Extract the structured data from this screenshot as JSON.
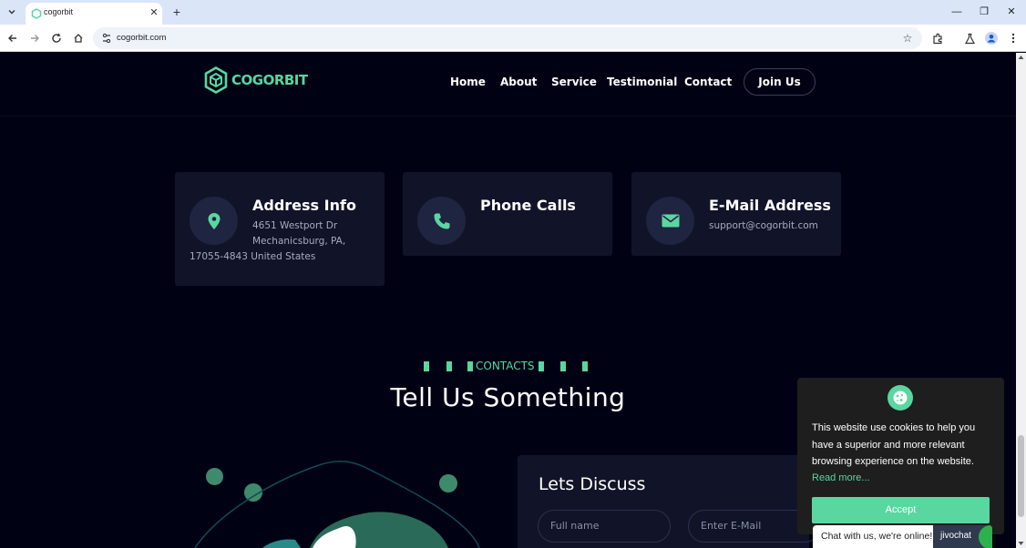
{
  "browser": {
    "tab_title": "cogorbit",
    "url": "cogorbit.com"
  },
  "site": {
    "logo_text": "COGORBIT",
    "nav": [
      "Home",
      "About",
      "Service",
      "Testimonial",
      "Contact"
    ],
    "join_label": "Join Us"
  },
  "cards": [
    {
      "title": "Address Info",
      "line1": "4651 Westport Dr",
      "line2": "Mechanicsburg, PA,",
      "line3": "17055-4843 United States",
      "icon": "map-pin-icon"
    },
    {
      "title": "Phone Calls",
      "icon": "phone-icon"
    },
    {
      "title": "E-Mail Address",
      "line1": "support@cogorbit.com",
      "icon": "envelope-icon"
    }
  ],
  "contacts": {
    "tag": "CONTACTS",
    "heading": "Tell Us Something"
  },
  "form": {
    "title": "Lets Discuss",
    "fullname_placeholder": "Full name",
    "email_placeholder": "Enter E-Mail"
  },
  "cookie": {
    "text": "This website use cookies to help you have a superior and more relevant browsing experience on the website.",
    "link": "Read more...",
    "accept": "Accept"
  },
  "chat": {
    "text": "Chat with us, we're online!",
    "brand": "jivochat"
  },
  "colors": {
    "accent": "#5ad6a0",
    "background": "#000214",
    "card": "#111428"
  }
}
